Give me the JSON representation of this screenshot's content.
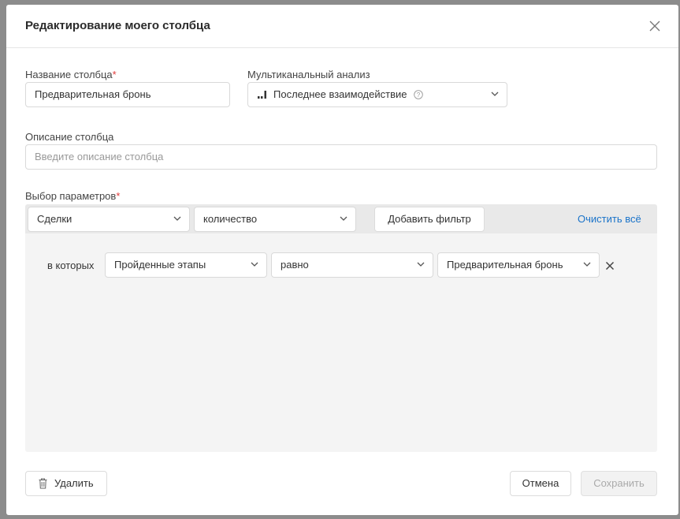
{
  "modal": {
    "title": "Редактирование моего столбца"
  },
  "form": {
    "column_name": {
      "label": "Название столбца",
      "required_mark": "*",
      "value": "Предварительная бронь"
    },
    "multichannel": {
      "label": "Мультиканальный анализ",
      "value": "Последнее взаимодействие",
      "help_icon": "question-circle-icon"
    },
    "description": {
      "label": "Описание столбца",
      "placeholder": "Введите описание столбца"
    },
    "params": {
      "label": "Выбор параметров",
      "required_mark": "*",
      "entity_select": "Сделки",
      "metric_select": "количество",
      "add_filter_label": "Добавить фильтр",
      "clear_all_label": "Очистить всё",
      "filters": [
        {
          "prefix": "в которых",
          "field": "Пройденные этапы",
          "operator": "равно",
          "value": "Предварительная бронь"
        }
      ]
    }
  },
  "footer": {
    "delete_label": "Удалить",
    "cancel_label": "Отмена",
    "save_label": "Сохранить"
  },
  "colors": {
    "accent_link": "#1a73c9",
    "required": "#e03b3b",
    "params_bar": "#e9e9e9",
    "params_body": "#f4f4f4"
  }
}
